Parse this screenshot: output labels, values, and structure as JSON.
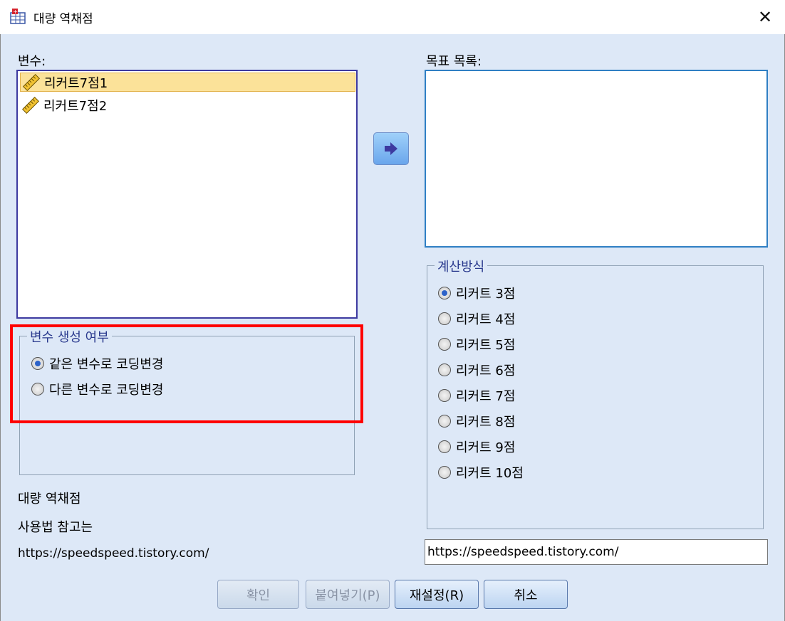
{
  "window": {
    "title": "대량 역채점",
    "close_glyph": "✕"
  },
  "variables": {
    "label": "변수:",
    "items": [
      {
        "label": "리커트7점1",
        "selected": true
      },
      {
        "label": "리커트7점2",
        "selected": false
      }
    ]
  },
  "target": {
    "label": "목표 목록:"
  },
  "creation_group": {
    "title": "변수 생성 여부",
    "options": [
      {
        "label": "같은 변수로 코딩변경",
        "checked": true
      },
      {
        "label": "다른 변수로 코딩변경",
        "checked": false
      }
    ]
  },
  "method_group": {
    "title": "계산방식",
    "options": [
      {
        "label": "리커트 3점",
        "checked": true
      },
      {
        "label": "리커트 4점",
        "checked": false
      },
      {
        "label": "리커트 5점",
        "checked": false
      },
      {
        "label": "리커트 6점",
        "checked": false
      },
      {
        "label": "리커트 7점",
        "checked": false
      },
      {
        "label": "리커트 8점",
        "checked": false
      },
      {
        "label": "리커트 9점",
        "checked": false
      },
      {
        "label": "리커트 10점",
        "checked": false
      }
    ]
  },
  "info": {
    "line1": "대량 역채점",
    "line2": "사용법 참고는",
    "line3": "https://speedspeed.tistory.com/"
  },
  "url_field": {
    "value": "https://speedspeed.tistory.com/"
  },
  "buttons": {
    "ok": "확인",
    "paste": "붙여넣기(P)",
    "reset": "재설정(R)",
    "cancel": "취소"
  },
  "colors": {
    "dialog_bg": "#dde8f7",
    "selection": "#fbe299",
    "highlight_box": "#ff0000",
    "group_title": "#2a3a8e"
  }
}
